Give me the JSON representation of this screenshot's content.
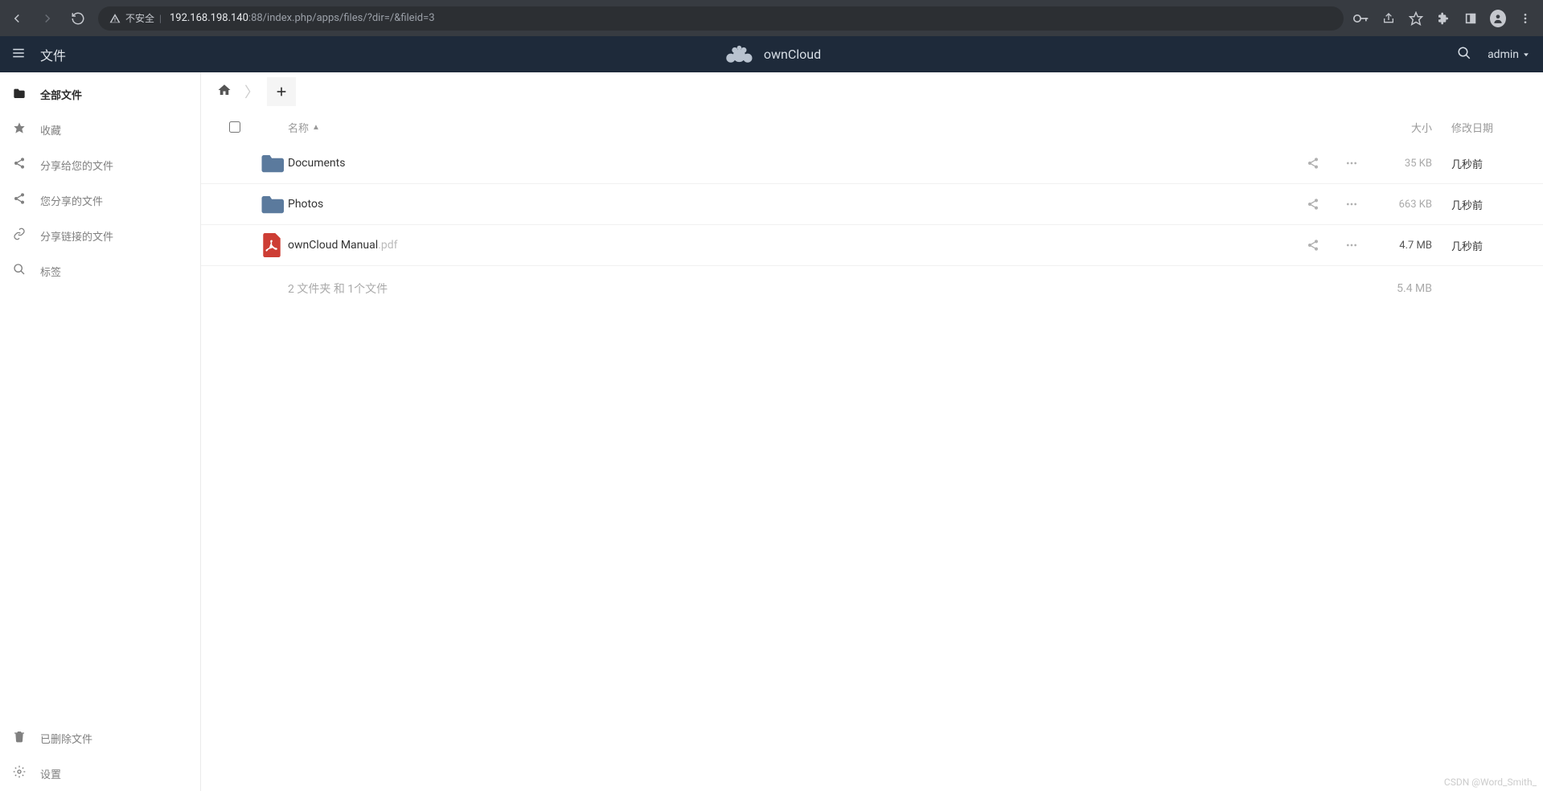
{
  "browser": {
    "insecure_label": "不安全",
    "url_host": "192.168.198.140",
    "url_path": ":88/index.php/apps/files/?dir=/&fileid=3"
  },
  "header": {
    "app_name": "文件",
    "brand": "ownCloud",
    "user": "admin"
  },
  "sidebar": {
    "items": [
      {
        "label": "全部文件"
      },
      {
        "label": "收藏"
      },
      {
        "label": "分享给您的文件"
      },
      {
        "label": "您分享的文件"
      },
      {
        "label": "分享链接的文件"
      },
      {
        "label": "标签"
      }
    ],
    "bottom": [
      {
        "label": "已删除文件"
      },
      {
        "label": "设置"
      }
    ]
  },
  "table": {
    "headers": {
      "name": "名称",
      "size": "大小",
      "modified": "修改日期"
    },
    "rows": [
      {
        "name": "Documents",
        "ext": "",
        "type": "folder",
        "size": "35 KB",
        "date": "几秒前"
      },
      {
        "name": "Photos",
        "ext": "",
        "type": "folder",
        "size": "663 KB",
        "date": "几秒前"
      },
      {
        "name": "ownCloud Manual",
        "ext": ".pdf",
        "type": "pdf",
        "size": "4.7 MB",
        "date": "几秒前"
      }
    ],
    "summary": {
      "text": "2 文件夹 和 1个文件",
      "size": "5.4 MB"
    }
  },
  "watermark": "CSDN @Word_Smith_"
}
